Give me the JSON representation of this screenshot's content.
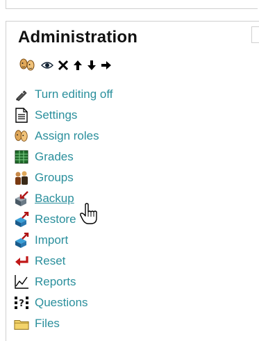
{
  "block": {
    "title": "Administration",
    "toolbar": [
      {
        "icon": "assign-roles-icon"
      },
      {
        "icon": "eye-icon"
      },
      {
        "icon": "delete-x-icon"
      },
      {
        "icon": "move-up-icon"
      },
      {
        "icon": "move-down-icon"
      },
      {
        "icon": "move-right-icon"
      }
    ],
    "items": [
      {
        "label": "Turn editing off",
        "icon": "edit-pen-icon"
      },
      {
        "label": "Settings",
        "icon": "settings-document-icon"
      },
      {
        "label": "Assign roles",
        "icon": "assign-roles-icon"
      },
      {
        "label": "Grades",
        "icon": "grades-icon"
      },
      {
        "label": "Groups",
        "icon": "groups-icon"
      },
      {
        "label": "Backup",
        "icon": "backup-icon",
        "hover": true
      },
      {
        "label": "Restore",
        "icon": "restore-icon"
      },
      {
        "label": "Import",
        "icon": "import-icon"
      },
      {
        "label": "Reset",
        "icon": "reset-icon"
      },
      {
        "label": "Reports",
        "icon": "reports-icon"
      },
      {
        "label": "Questions",
        "icon": "questions-icon"
      },
      {
        "label": "Files",
        "icon": "folder-icon"
      }
    ]
  },
  "colors": {
    "link": "#2a8f9c",
    "title": "#111111",
    "border": "#cfcfcf"
  }
}
